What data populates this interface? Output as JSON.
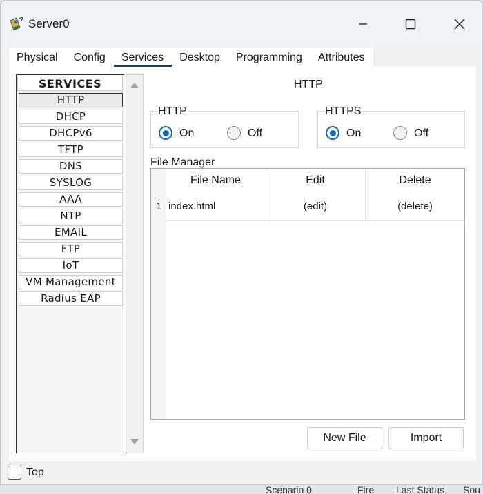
{
  "window": {
    "title": "Server0",
    "icon": "server-router-icon"
  },
  "tabs": [
    {
      "label": "Physical",
      "active": false
    },
    {
      "label": "Config",
      "active": false
    },
    {
      "label": "Services",
      "active": true
    },
    {
      "label": "Desktop",
      "active": false
    },
    {
      "label": "Programming",
      "active": false
    },
    {
      "label": "Attributes",
      "active": false
    }
  ],
  "services": {
    "header": "SERVICES",
    "items": [
      "HTTP",
      "DHCP",
      "DHCPv6",
      "TFTP",
      "DNS",
      "SYSLOG",
      "AAA",
      "NTP",
      "EMAIL",
      "FTP",
      "IoT",
      "VM Management",
      "Radius EAP"
    ],
    "selected": "HTTP"
  },
  "http_panel": {
    "title": "HTTP",
    "http": {
      "label": "HTTP",
      "on_label": "On",
      "off_label": "Off",
      "value": "On"
    },
    "https": {
      "label": "HTTPS",
      "on_label": "On",
      "off_label": "Off",
      "value": "On"
    }
  },
  "file_manager": {
    "label": "File Manager",
    "columns": [
      "File Name",
      "Edit",
      "Delete"
    ],
    "rows": [
      {
        "index": "1",
        "file_name": "index.html",
        "edit": "(edit)",
        "delete": "(delete)"
      }
    ]
  },
  "buttons": {
    "new_file": "New File",
    "import": "Import"
  },
  "bottom": {
    "top_label": "Top",
    "top_checked": false
  },
  "underlay_text": {
    "scenario": "Scenario 0",
    "fire": "Fire",
    "last_status": "Last Status",
    "sou": "Sou"
  },
  "colors": {
    "accent": "#1767c2",
    "tab_underline": "#1f3a5f",
    "titlebar": "#eef3f5"
  }
}
